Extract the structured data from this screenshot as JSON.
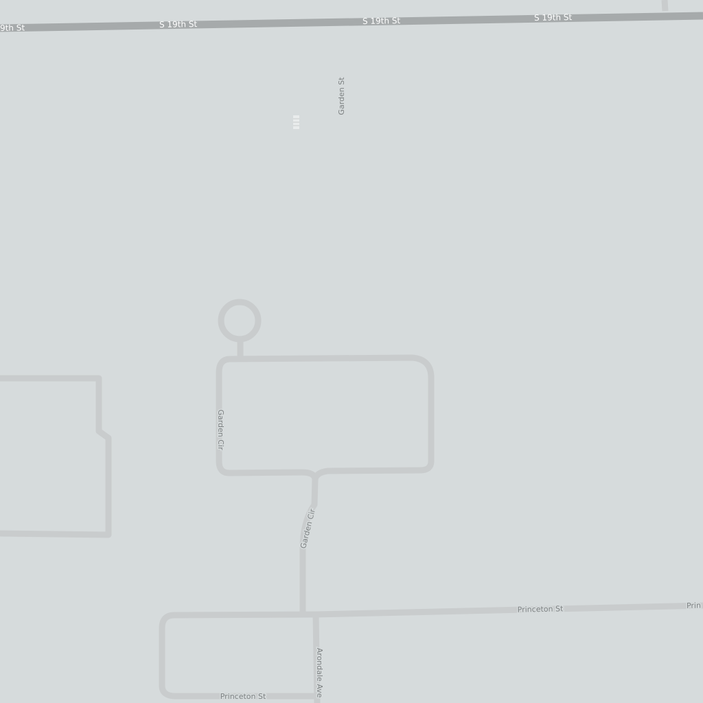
{
  "map": {
    "background_color": "#d6dbdc",
    "major_road_color": "#a6aaab",
    "minor_road_color": "#c9cccd",
    "street_labels": {
      "s19th_left": "9th St",
      "s19th_1": "S 19th St",
      "s19th_2": "S 19th St",
      "s19th_3": "S 19th St",
      "garden_st": "Garden St",
      "garden_cir_west": "Garden Cir",
      "garden_cir_south": "Garden Cir",
      "princeton_east": "Princeton St",
      "princeton_edge": "Prin",
      "princeton_south": "Princeton St",
      "arondale": "Arondale Ave"
    }
  }
}
